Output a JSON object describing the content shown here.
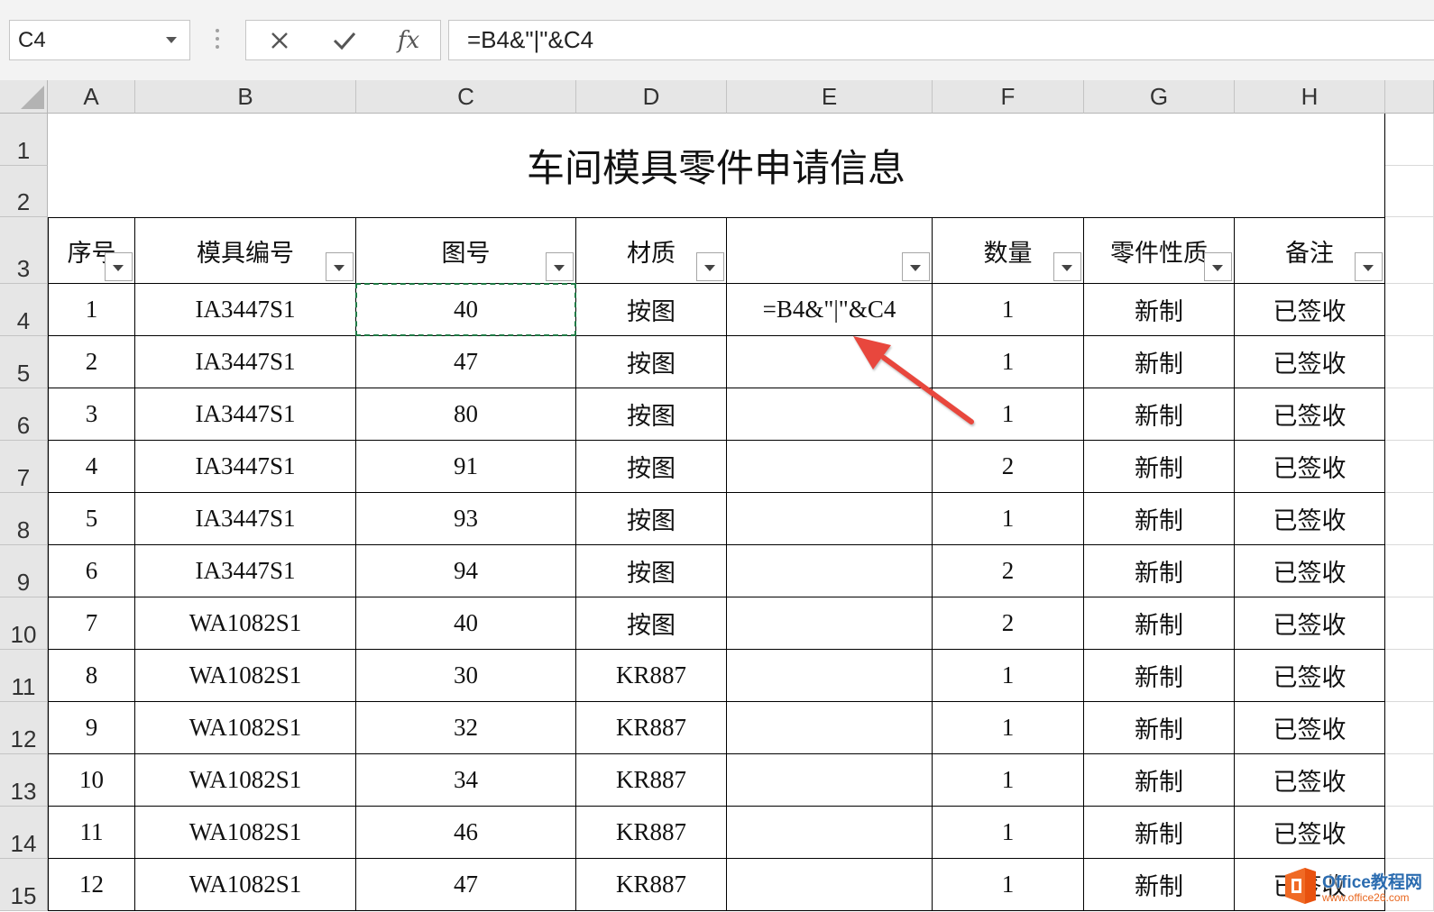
{
  "name_box": {
    "value": "C4"
  },
  "formula_bar": {
    "insert_function_label": "fx",
    "value": "=B4&\"|\"&C4"
  },
  "icons": {
    "name_box_dropdown": "chevron-down-icon",
    "grip": "more-vertical-icon",
    "cancel": "close-icon",
    "enter": "check-icon",
    "select_all": "select-all-icon",
    "filter": "filter-dropdown-icon",
    "watermark_logo": "office-logo"
  },
  "columns": [
    "A",
    "B",
    "C",
    "D",
    "E",
    "F",
    "G",
    "H"
  ],
  "rows": [
    "1",
    "2",
    "3",
    "4",
    "5",
    "6",
    "7",
    "8",
    "9",
    "10",
    "11",
    "12",
    "13",
    "14",
    "15"
  ],
  "sheet": {
    "title": "车间模具零件申请信息",
    "headers": [
      "序号",
      "模具编号",
      "图号",
      "材质",
      "",
      "数量",
      "零件性质",
      "备注"
    ],
    "records": [
      [
        "1",
        "IA3447S1",
        "40",
        "按图",
        "=B4&\"|\"&C4",
        "1",
        "新制",
        "已签收"
      ],
      [
        "2",
        "IA3447S1",
        "47",
        "按图",
        "",
        "1",
        "新制",
        "已签收"
      ],
      [
        "3",
        "IA3447S1",
        "80",
        "按图",
        "",
        "1",
        "新制",
        "已签收"
      ],
      [
        "4",
        "IA3447S1",
        "91",
        "按图",
        "",
        "2",
        "新制",
        "已签收"
      ],
      [
        "5",
        "IA3447S1",
        "93",
        "按图",
        "",
        "1",
        "新制",
        "已签收"
      ],
      [
        "6",
        "IA3447S1",
        "94",
        "按图",
        "",
        "2",
        "新制",
        "已签收"
      ],
      [
        "7",
        "WA1082S1",
        "40",
        "按图",
        "",
        "2",
        "新制",
        "已签收"
      ],
      [
        "8",
        "WA1082S1",
        "30",
        "KR887",
        "",
        "1",
        "新制",
        "已签收"
      ],
      [
        "9",
        "WA1082S1",
        "32",
        "KR887",
        "",
        "1",
        "新制",
        "已签收"
      ],
      [
        "10",
        "WA1082S1",
        "34",
        "KR887",
        "",
        "1",
        "新制",
        "已签收"
      ],
      [
        "11",
        "WA1082S1",
        "46",
        "KR887",
        "",
        "1",
        "新制",
        "已签收"
      ],
      [
        "12",
        "WA1082S1",
        "47",
        "KR887",
        "",
        "1",
        "新制",
        "已签收"
      ]
    ]
  },
  "colors": {
    "copy_marquee": "#1f7a45",
    "table_border": "#000000",
    "header_background": "#e6e6e6",
    "annotation_arrow": "#e8473d"
  },
  "watermark": {
    "brand": "Office教程网",
    "url": "www.office26.com"
  }
}
